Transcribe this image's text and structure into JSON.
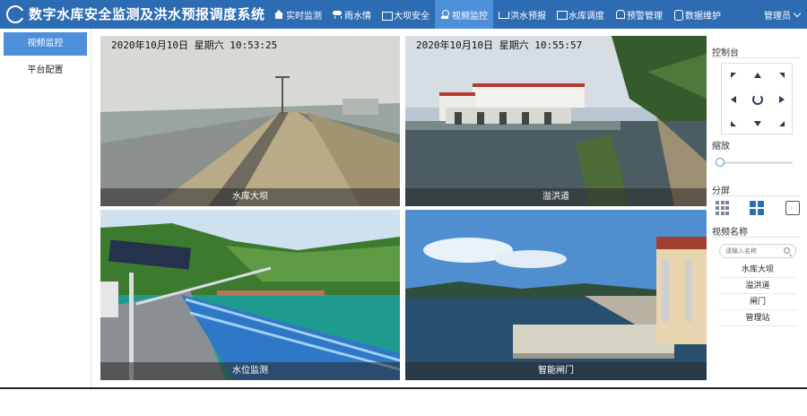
{
  "app": {
    "title": "数字水库安全监测及洪水预报调度系统"
  },
  "nav": {
    "items": [
      {
        "label": "实时监测",
        "icon": "home-icon"
      },
      {
        "label": "雨水情",
        "icon": "rain-icon"
      },
      {
        "label": "大坝安全",
        "icon": "dam-icon"
      },
      {
        "label": "视频监控",
        "icon": "camera-icon",
        "active": true
      },
      {
        "label": "洪水预报",
        "icon": "flood-icon"
      },
      {
        "label": "水库调度",
        "icon": "dispatch-icon"
      },
      {
        "label": "预警管理",
        "icon": "bell-icon"
      },
      {
        "label": "数据维护",
        "icon": "database-icon"
      }
    ],
    "user": "管理员"
  },
  "sidebar": {
    "items": [
      {
        "label": "视频监控",
        "active": true
      },
      {
        "label": "平台配置",
        "active": false
      }
    ]
  },
  "videos": [
    {
      "caption": "水库大坝",
      "timestamp": "2020年10月10日  星期六  10:53:25"
    },
    {
      "caption": "溢洪道",
      "timestamp": "2020年10月10日  星期六  10:55:57"
    },
    {
      "caption": "水位监测",
      "timestamp": ""
    },
    {
      "caption": "智能闸门",
      "timestamp": ""
    }
  ],
  "panel": {
    "control_title": "控制台",
    "zoom_title": "缩放",
    "zoom_level": 0,
    "layout_title": "分屏",
    "layout_selected": "2x2",
    "video_name_title": "视频名称",
    "search_placeholder": "请输入名称",
    "video_list": [
      "水库大坝",
      "溢洪道",
      "闸门",
      "管理站"
    ]
  },
  "colors": {
    "header": "#2d6cb3",
    "active": "#4d8fd8",
    "ptz_arrow": "#2b3b57"
  }
}
